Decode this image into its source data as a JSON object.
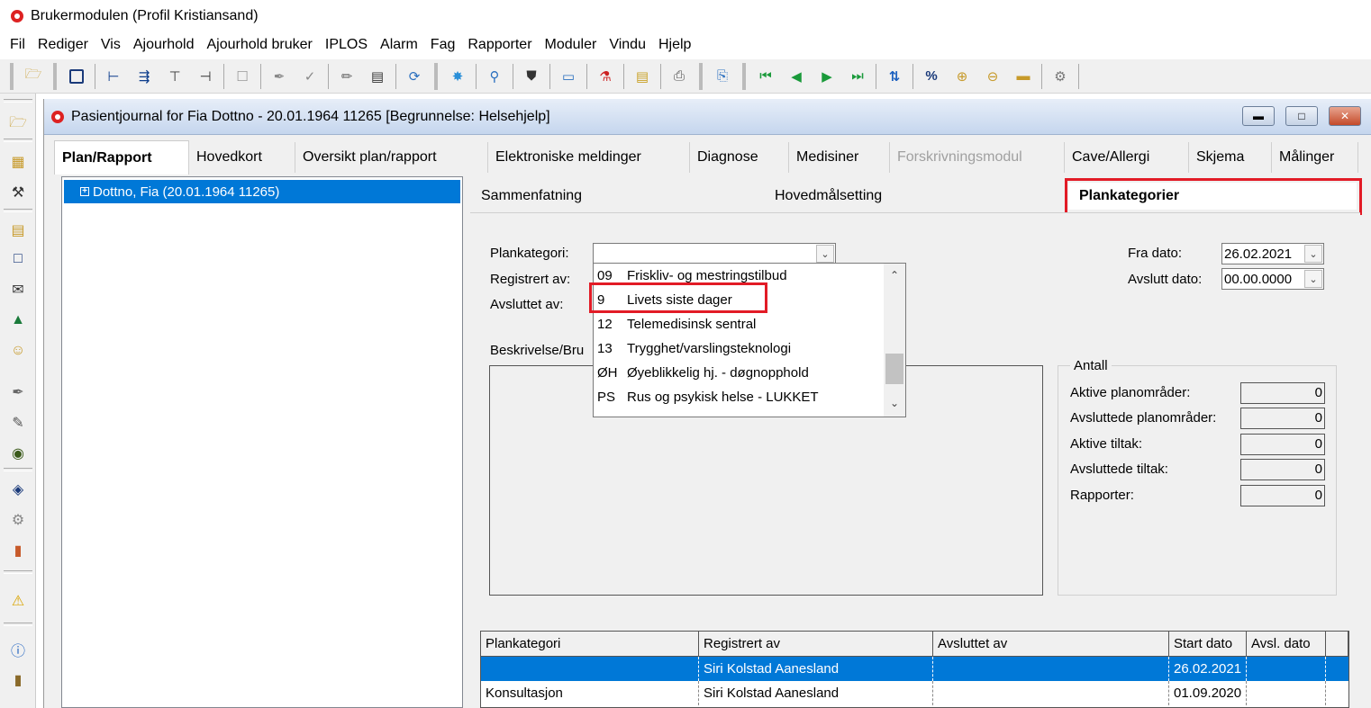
{
  "app": {
    "title": "Brukermodulen (Profil Kristiansand)"
  },
  "menu": [
    "Fil",
    "Rediger",
    "Vis",
    "Ajourhold",
    "Ajourhold bruker",
    "IPLOS",
    "Alarm",
    "Fag",
    "Rapporter",
    "Moduler",
    "Vindu",
    "Hjelp"
  ],
  "child": {
    "title": "Pasientjournal for Fia Dottno - 20.01.1964 11265  [Begrunnelse: Helsehjelp]"
  },
  "tabs": [
    "Plan/Rapport",
    "Hovedkort",
    "Oversikt plan/rapport",
    "Elektroniske meldinger",
    "Diagnose",
    "Medisiner",
    "Forskrivningsmodul",
    "Cave/Allergi",
    "Skjema",
    "Målinger"
  ],
  "tree": {
    "item": "Dottno, Fia (20.01.1964 11265)"
  },
  "subtabs": [
    "Sammenfatning",
    "Hovedmålsetting",
    "Plankategorier"
  ],
  "form": {
    "plankategori_label": "Plankategori:",
    "registrert_label": "Registrert av:",
    "avsluttet_label": "Avsluttet av:",
    "beskrivelse_label": "Beskrivelse/Bru",
    "fra_dato_label": "Fra dato:",
    "fra_dato_value": "26.02.2021",
    "avslutt_dato_label": "Avslutt dato:",
    "avslutt_dato_value": "00.00.0000"
  },
  "dropdown": [
    {
      "code": "09",
      "label": "Friskliv- og mestringstilbud"
    },
    {
      "code": "9",
      "label": "Livets siste dager"
    },
    {
      "code": "12",
      "label": "Telemedisinsk sentral"
    },
    {
      "code": "13",
      "label": "Trygghet/varslingsteknologi"
    },
    {
      "code": "ØH",
      "label": "Øyeblikkelig hj. - døgnopphold"
    },
    {
      "code": "PS",
      "label": "Rus og psykisk helse - LUKKET"
    }
  ],
  "antall": {
    "title": "Antall",
    "rows": [
      {
        "label": "Aktive planområder:",
        "value": "0"
      },
      {
        "label": "Avsluttede planområder:",
        "value": "0"
      },
      {
        "label": "Aktive tiltak:",
        "value": "0"
      },
      {
        "label": "Avsluttede tiltak:",
        "value": "0"
      },
      {
        "label": "Rapporter:",
        "value": "0"
      }
    ]
  },
  "grid": {
    "headers": [
      "Plankategori",
      "Registrert av",
      "Avsluttet av",
      "Start dato",
      "Avsl. dato"
    ],
    "rows": [
      [
        "",
        "Siri Kolstad Aanesland",
        "",
        "26.02.2021",
        ""
      ],
      [
        "Konsultasjon",
        "Siri Kolstad Aanesland",
        "",
        "01.09.2020",
        ""
      ]
    ]
  },
  "colors": {
    "selection": "#0078d7",
    "highlight": "#e21b26"
  }
}
